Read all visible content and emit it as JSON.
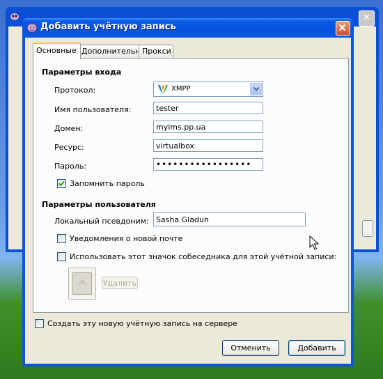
{
  "window": {
    "title": "Добавить учётную запись"
  },
  "tabs": [
    {
      "label": "Основные",
      "active": true
    },
    {
      "label": "Дополнительно",
      "active": false
    },
    {
      "label": "Прокси",
      "active": false
    }
  ],
  "login": {
    "section_title": "Параметры входа",
    "protocol_label": "Протокол:",
    "protocol_value": "XMPP",
    "username_label": "Имя пользователя:",
    "username_value": "tester",
    "domain_label": "Домен:",
    "domain_value": "myims.pp.ua",
    "resource_label": "Ресурс:",
    "resource_value": "virtualbox",
    "password_label": "Пароль:",
    "password_value": "•••••••••••••••••",
    "remember_label": "Запомнить пароль",
    "remember_checked": true
  },
  "user": {
    "section_title": "Параметры пользователя",
    "alias_label": "Локальный псевдоним:",
    "alias_value": "Sasha Gladun",
    "mail_notify_label": "Уведомления о новой почте",
    "mail_notify_checked": false,
    "buddy_icon_label": "Использовать этот значок собеседника для этой учётной записи:",
    "buddy_icon_checked": false,
    "remove_label": "Удалить"
  },
  "register": {
    "label": "Создать эту новую учётную запись на сервере",
    "checked": false
  },
  "buttons": {
    "cancel": "Отменить",
    "add": "Добавить"
  },
  "colors": {
    "titlebar": "#0453dd",
    "client_bg": "#ece9d8",
    "tab_highlight": "#ffc73c"
  }
}
